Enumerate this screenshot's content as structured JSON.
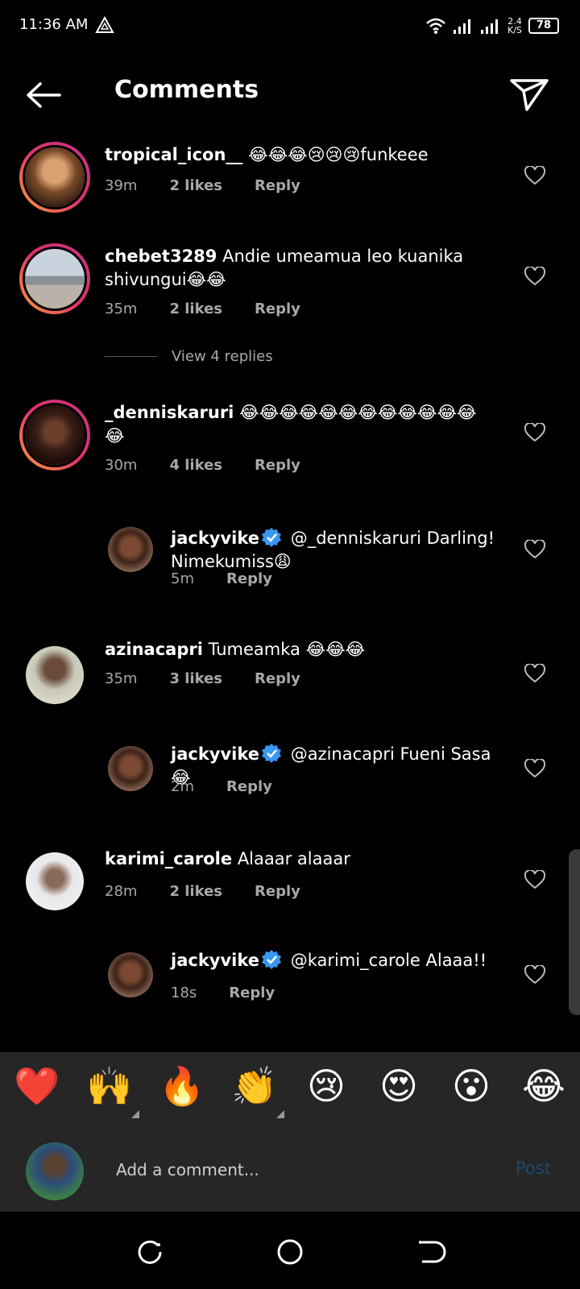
{
  "status_bar": {
    "time": "11:36 AM",
    "speed_value": "2.4",
    "speed_unit": "K/S",
    "battery": "78",
    "icons": [
      "alert-triangle-icon",
      "wifi-icon",
      "signal-icon",
      "signal-icon"
    ]
  },
  "header": {
    "title": "Comments",
    "back_icon": "back-arrow-icon",
    "send_icon": "send-icon"
  },
  "comments": [
    {
      "username": "tropical_icon__",
      "text": "😂😂😂😢😢😢funkeee",
      "time": "39m",
      "likes": "2 likes",
      "reply": "Reply"
    },
    {
      "username": "chebet3289",
      "text": "Andie umeamua leo kuanika shivungui😂😂",
      "time": "35m",
      "likes": "2 likes",
      "reply": "Reply"
    },
    {
      "username": "_denniskaruri",
      "text": "😂😂😂😂😂😂😂😂😂😂😂😂😂",
      "time": "30m",
      "likes": "4 likes",
      "reply": "Reply"
    },
    {
      "username": "jackyvike",
      "text": "@_denniskaruri Darling! Nimekumiss😩",
      "time": "5m",
      "reply": "Reply"
    },
    {
      "username": "azinacapri",
      "text": "Tumeamka 😂😂😂",
      "time": "35m",
      "likes": "3 likes",
      "reply": "Reply"
    },
    {
      "username": "jackyvike",
      "text": "@azinacapri Fueni Sasa😂",
      "time": "2m",
      "reply": "Reply"
    },
    {
      "username": "karimi_carole",
      "text": "Alaaar alaaar",
      "time": "28m",
      "likes": "2 likes",
      "reply": "Reply"
    },
    {
      "username": "jackyvike",
      "text": "@karimi_carole Alaaa!!",
      "time": "18s",
      "reply": "Reply"
    }
  ],
  "view_replies": "View 4 replies",
  "emoji_bar": [
    "❤️",
    "🙌",
    "🔥",
    "👏",
    "😢",
    "😍",
    "😮",
    "😂"
  ],
  "add_comment": {
    "placeholder": "Add a comment...",
    "post_label": "Post"
  },
  "colors": {
    "background": "#000000",
    "panel": "#262626",
    "secondary_text": "#a8a8a8",
    "verified": "#3897f0",
    "post_disabled": "#1d4a6e"
  }
}
